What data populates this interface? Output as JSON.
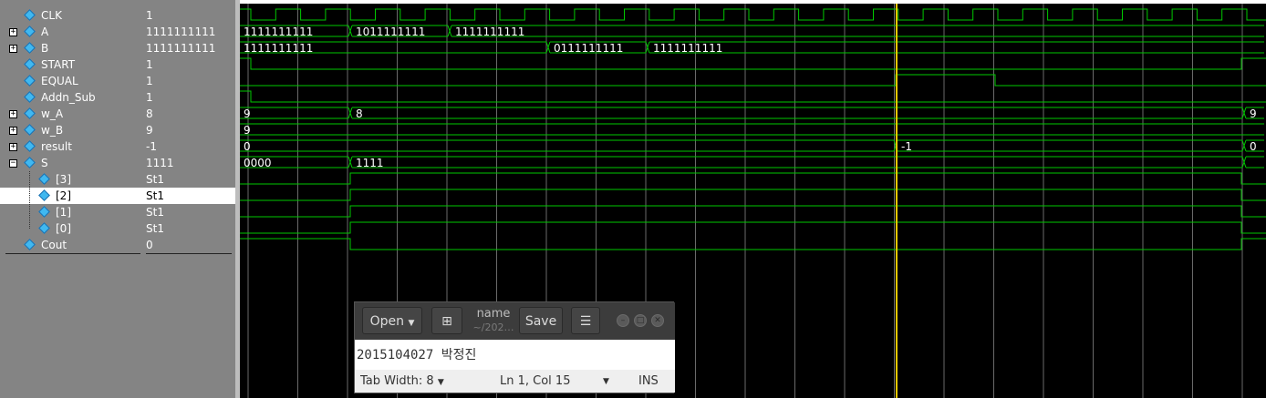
{
  "signals": [
    {
      "name": "CLK",
      "value": "1",
      "expand": "",
      "indent": 0
    },
    {
      "name": "A",
      "value": "1111111111",
      "expand": "+",
      "indent": 0
    },
    {
      "name": "B",
      "value": "1111111111",
      "expand": "+",
      "indent": 0
    },
    {
      "name": "START",
      "value": "1",
      "expand": "",
      "indent": 0
    },
    {
      "name": "EQUAL",
      "value": "1",
      "expand": "",
      "indent": 0
    },
    {
      "name": "Addn_Sub",
      "value": "1",
      "expand": "",
      "indent": 0
    },
    {
      "name": "w_A",
      "value": "8",
      "expand": "+",
      "indent": 0
    },
    {
      "name": "w_B",
      "value": "9",
      "expand": "+",
      "indent": 0
    },
    {
      "name": "result",
      "value": "-1",
      "expand": "+",
      "indent": 0
    },
    {
      "name": "S",
      "value": "1111",
      "expand": "-",
      "indent": 0
    },
    {
      "name": "[3]",
      "value": "St1",
      "expand": "",
      "indent": 1
    },
    {
      "name": "[2]",
      "value": "St1",
      "expand": "",
      "indent": 1,
      "selected": true
    },
    {
      "name": "[1]",
      "value": "St1",
      "expand": "",
      "indent": 1
    },
    {
      "name": "[0]",
      "value": "St1",
      "expand": "",
      "indent": 1
    },
    {
      "name": "Cout",
      "value": "0",
      "expand": "",
      "indent": 0
    }
  ],
  "bus_labels": {
    "A": [
      "1111111111",
      "1011111111",
      "1111111111"
    ],
    "B": [
      "1111111111",
      "0111111111",
      "1111111111"
    ],
    "w_A": [
      "9",
      "8",
      "9"
    ],
    "w_B": [
      "9"
    ],
    "result": [
      "0",
      "-1",
      "0"
    ],
    "S": [
      "0000",
      "1111"
    ]
  },
  "colors": {
    "wave": "#00c800",
    "cursor": "#e8c800",
    "grid": "#6a6a6a",
    "background": "#000000",
    "panel": "#848484"
  },
  "gedit": {
    "open_label": "Open",
    "save_label": "Save",
    "title": "name",
    "subtitle": "~/202…",
    "text": "2015104027 박정진",
    "tab_width": "Tab Width: 8",
    "position": "Ln 1, Col 15",
    "mode": "INS"
  }
}
